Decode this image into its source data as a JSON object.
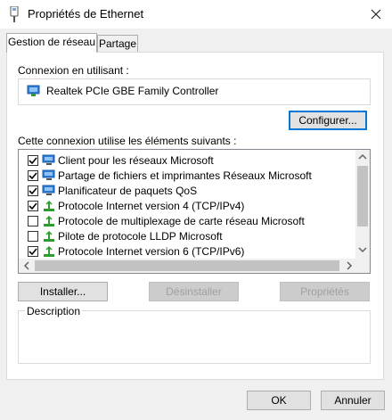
{
  "window": {
    "title": "Propriétés de Ethernet"
  },
  "tabs": [
    {
      "label": "Gestion de réseau"
    },
    {
      "label": "Partage"
    }
  ],
  "connection": {
    "label": "Connexion en utilisant :",
    "adapter": "Realtek PCIe GBE Family Controller",
    "configure_button": "Configurer..."
  },
  "items_section": {
    "label": "Cette connexion utilise les éléments suivants :",
    "items": [
      {
        "label": "Client pour les réseaux Microsoft",
        "checked": true,
        "icon": "network-client-icon"
      },
      {
        "label": "Partage de fichiers et imprimantes Réseaux Microsoft",
        "checked": true,
        "icon": "network-client-icon"
      },
      {
        "label": "Planificateur de paquets QoS",
        "checked": true,
        "icon": "network-client-icon"
      },
      {
        "label": "Protocole Internet version 4 (TCP/IPv4)",
        "checked": true,
        "icon": "protocol-icon"
      },
      {
        "label": "Protocole de multiplexage de carte réseau Microsoft",
        "checked": false,
        "icon": "protocol-icon"
      },
      {
        "label": "Pilote de protocole LLDP Microsoft",
        "checked": false,
        "icon": "protocol-icon"
      },
      {
        "label": "Protocole Internet version 6 (TCP/IPv6)",
        "checked": true,
        "icon": "protocol-icon"
      }
    ]
  },
  "buttons": {
    "install": "Installer...",
    "uninstall": "Désinstaller",
    "properties": "Propriétés",
    "ok": "OK",
    "cancel": "Annuler"
  },
  "description": {
    "title": "Description"
  },
  "colors": {
    "accent": "#0078d7",
    "protocol_green": "#2e9b2e",
    "monitor_blue": "#2b7bd6"
  }
}
